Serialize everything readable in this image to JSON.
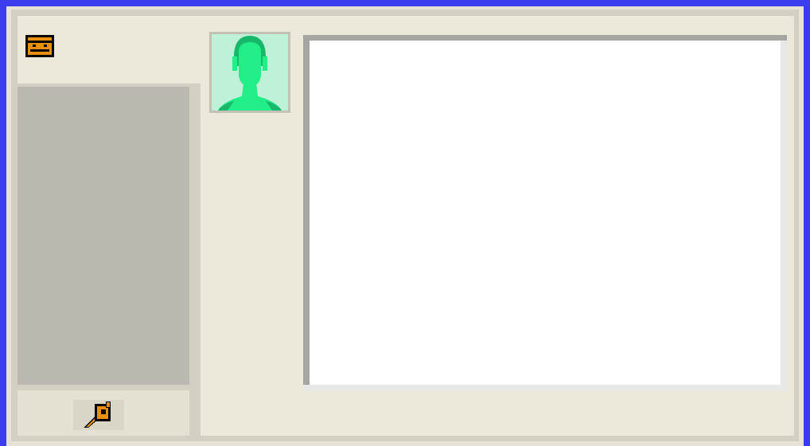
{
  "window": {
    "background_color": "#3b3bf0",
    "surface_color": "#ece9da"
  },
  "icons": {
    "mail": "mail-icon",
    "settings": "wrench-icon",
    "avatar": "person-silhouette-icon"
  },
  "colors": {
    "icon_accent": "#e8900e",
    "avatar_green": "#22ee88",
    "contact_list_bg": "#bbb8af",
    "viewer_bg": "#ffffff"
  }
}
